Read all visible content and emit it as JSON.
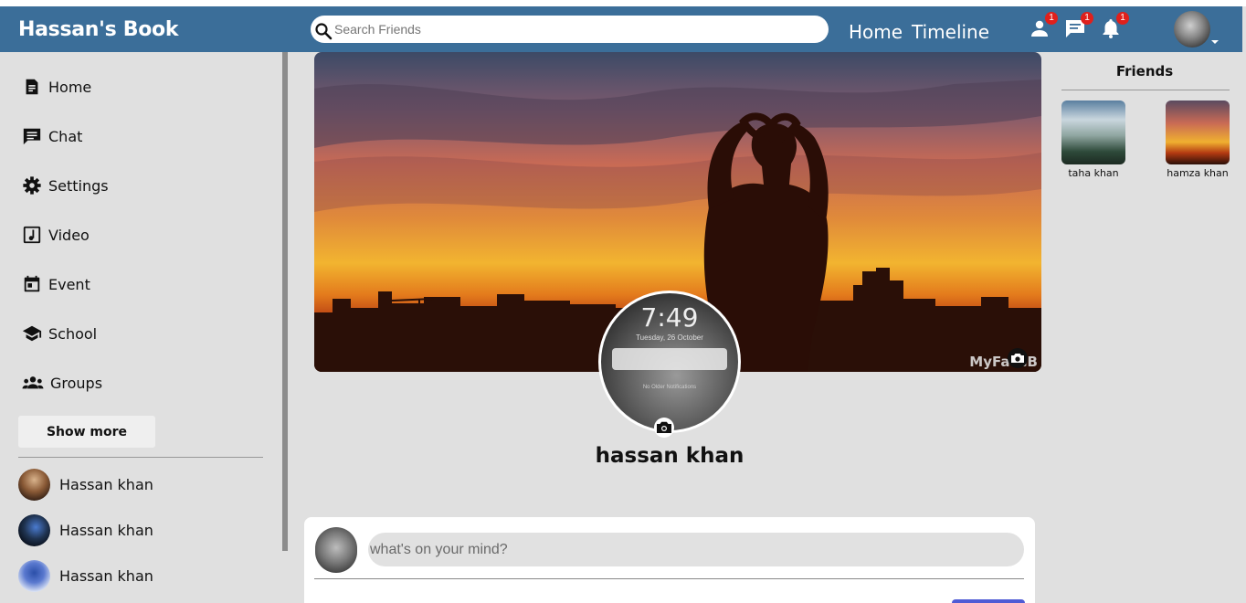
{
  "navbar": {
    "brand": "Hassan's Book",
    "search_placeholder": "Search Friends",
    "links": [
      "Home",
      "Timeline"
    ],
    "badges": {
      "friend_requests": "1",
      "messages": "1",
      "notifications": "1"
    }
  },
  "sidebar": {
    "items": [
      {
        "label": "Home",
        "icon": "document-icon"
      },
      {
        "label": "Chat",
        "icon": "chat-icon"
      },
      {
        "label": "Settings",
        "icon": "gear-icon"
      },
      {
        "label": "Video",
        "icon": "music-note-icon"
      },
      {
        "label": "Event",
        "icon": "calendar-icon"
      },
      {
        "label": "School",
        "icon": "school-icon"
      },
      {
        "label": "Groups",
        "icon": "groups-icon"
      }
    ],
    "show_more": "Show more",
    "contacts": [
      "Hassan khan",
      "Hassan khan",
      "Hassan khan"
    ]
  },
  "cover": {
    "watermark": "MyFaceB"
  },
  "profile": {
    "name": "hassan khan",
    "lock_time": "7:49",
    "lock_date": "Tuesday, 26 October",
    "no_older": "No Older Notifications"
  },
  "post": {
    "placeholder": "what's on your mind?"
  },
  "friends": {
    "title": "Friends",
    "list": [
      "taha khan",
      "hamza khan"
    ]
  },
  "colors": {
    "navbar": "#3b6e99",
    "badge": "#e0201c",
    "post_button": "#4f5bd5"
  }
}
